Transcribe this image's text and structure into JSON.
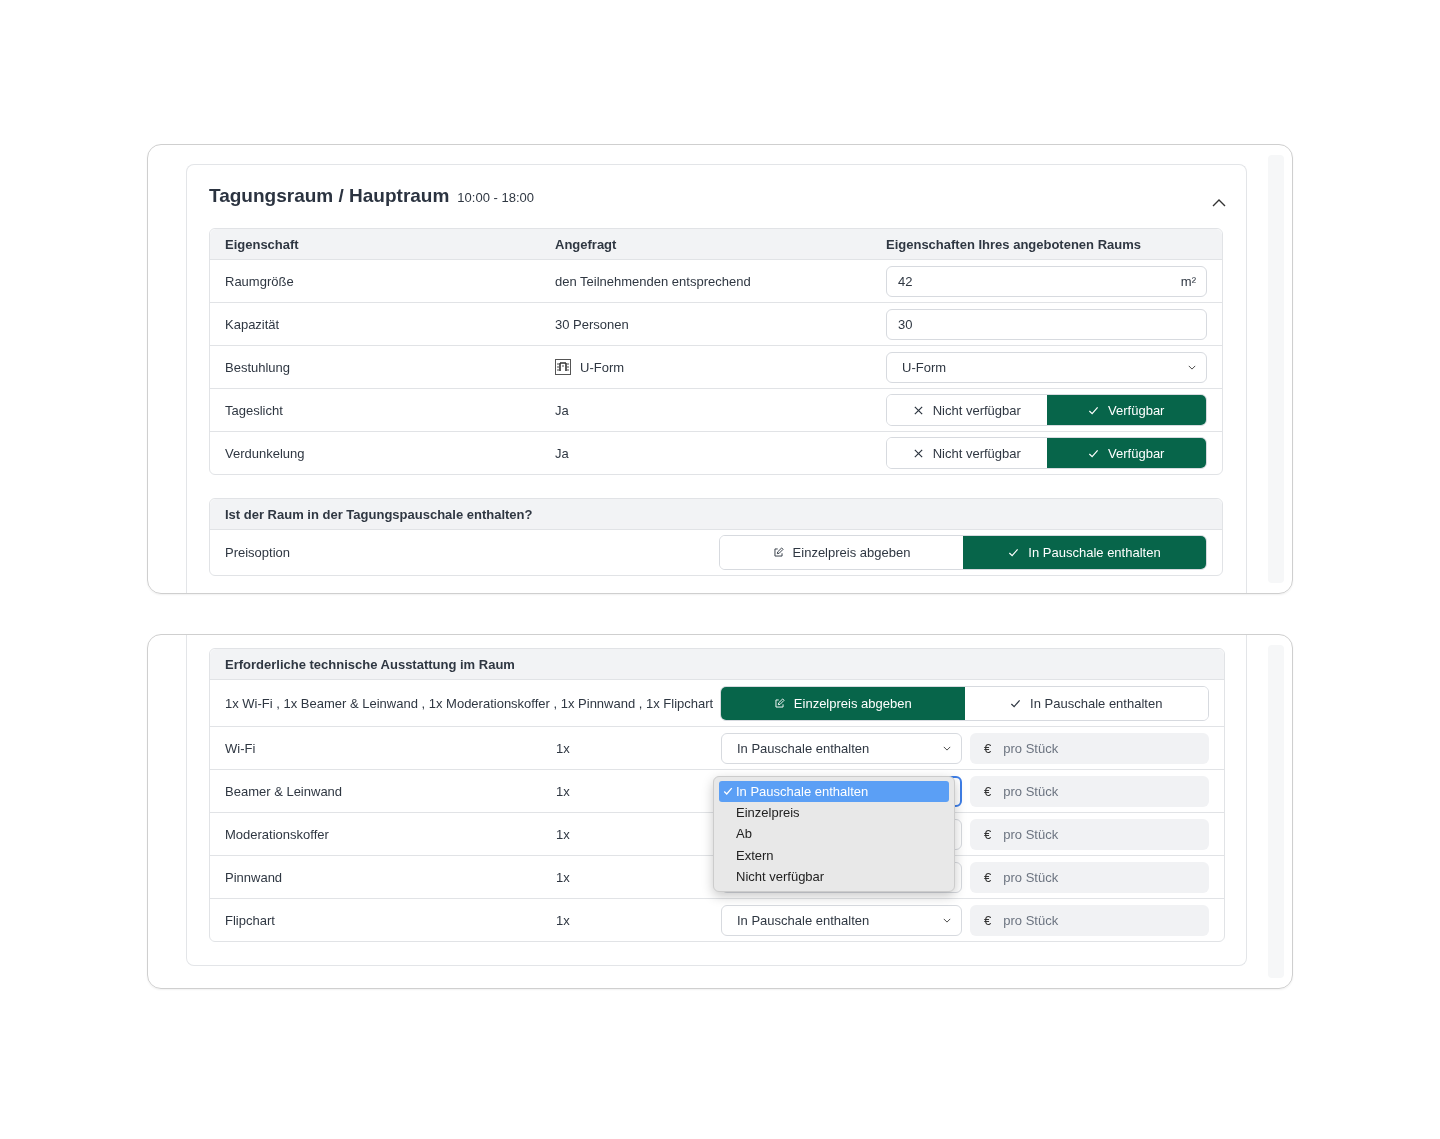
{
  "room_section": {
    "title": "Tagungsraum / Hauptraum",
    "time": "10:00 - 18:00",
    "expanded": true,
    "columns": [
      "Eigenschaft",
      "Angefragt",
      "Eigenschaften Ihres angebotenen Raums"
    ],
    "rows": [
      {
        "kind": "input",
        "property": "Raumgröße",
        "requested": "den Teilnehmenden entsprechend",
        "value": "42",
        "unit": "m²"
      },
      {
        "kind": "input",
        "property": "Kapazität",
        "requested": "30 Personen",
        "value": "30"
      },
      {
        "kind": "select",
        "property": "Bestuhlung",
        "requested": "U-Form",
        "requested_icon": true,
        "value": "U-Form"
      },
      {
        "kind": "toggle",
        "property": "Tageslicht",
        "requested": "Ja",
        "options": [
          {
            "kind": "reject",
            "label": "Nicht verfügbar",
            "selected": false
          },
          {
            "kind": "accept",
            "label": "Verfügbar",
            "selected": true
          }
        ]
      },
      {
        "kind": "toggle",
        "property": "Verdunkelung",
        "requested": "Ja",
        "options": [
          {
            "kind": "reject",
            "label": "Nicht verfügbar",
            "selected": false
          },
          {
            "kind": "accept",
            "label": "Verfügbar",
            "selected": true
          }
        ]
      }
    ],
    "price_section": {
      "heading": "Ist der Raum in der Tagungspauschale enthalten?",
      "label": "Preisoption",
      "options": [
        {
          "kind": "edit",
          "label": "Einzelpreis abgeben",
          "selected": false
        },
        {
          "kind": "accept",
          "label": "In Pauschale enthalten",
          "selected": true
        }
      ]
    }
  },
  "equipment_section": {
    "heading": "Erforderliche technische Ausstattung im Raum",
    "summary": "1x Wi-Fi , 1x Beamer & Leinwand , 1x Moderationskoffer , 1x Pinnwand , 1x Flipchart",
    "options": [
      {
        "kind": "edit",
        "label": "Einzelpreis abgeben",
        "selected": true
      },
      {
        "kind": "accept",
        "label": "In Pauschale enthalten",
        "selected": false
      }
    ],
    "items": [
      {
        "name": "Wi-Fi",
        "quantity": "1x",
        "option": "In Pauschale enthalten",
        "open": false,
        "currency": "€",
        "placeholder": "pro Stück"
      },
      {
        "name": "Beamer & Leinwand",
        "quantity": "1x",
        "open": true,
        "menu": [
          {
            "label": "In Pauschale enthalten",
            "selected": true
          },
          {
            "label": "Einzelpreis",
            "selected": false
          },
          {
            "label": "Ab",
            "selected": false
          },
          {
            "label": "Extern",
            "selected": false
          },
          {
            "label": "Nicht verfügbar",
            "selected": false
          }
        ],
        "currency": "€",
        "placeholder": "pro Stück"
      },
      {
        "name": "Moderationskoffer",
        "quantity": "1x",
        "open": false,
        "currency": "€",
        "placeholder": "pro Stück"
      },
      {
        "name": "Pinnwand",
        "quantity": "1x",
        "open": false,
        "currency": "€",
        "placeholder": "pro Stück"
      },
      {
        "name": "Flipchart",
        "quantity": "1x",
        "option": "In Pauschale enthalten",
        "open": false,
        "currency": "€",
        "placeholder": "pro Stück"
      }
    ]
  }
}
